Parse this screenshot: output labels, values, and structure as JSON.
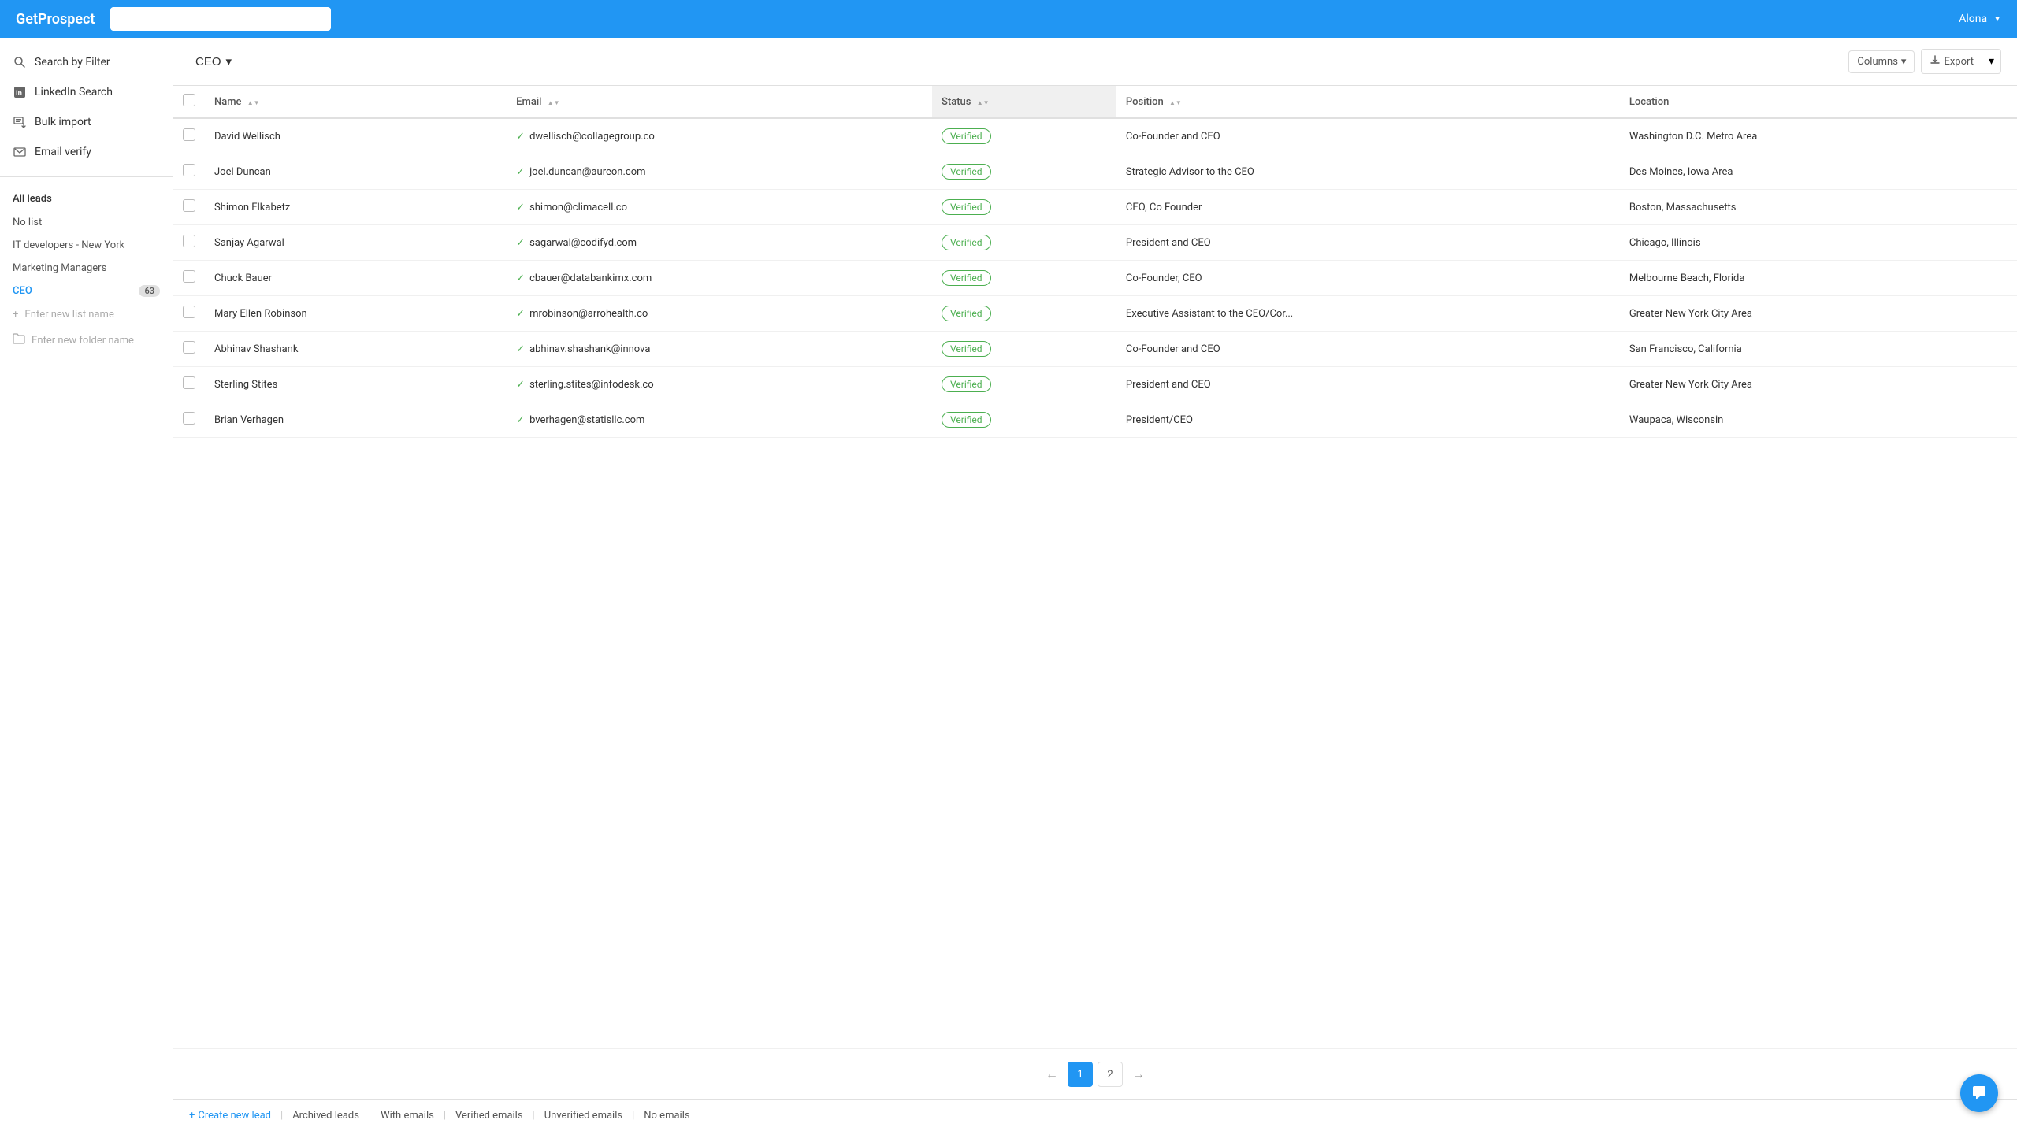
{
  "header": {
    "logo": "GetProspect",
    "search_placeholder": "",
    "user": "Alona"
  },
  "sidebar": {
    "nav_items": [
      {
        "id": "search-filter",
        "label": "Search by Filter",
        "icon": "search"
      },
      {
        "id": "linkedin-search",
        "label": "LinkedIn Search",
        "icon": "linkedin"
      },
      {
        "id": "bulk-import",
        "label": "Bulk import",
        "icon": "bulk"
      },
      {
        "id": "email-verify",
        "label": "Email verify",
        "icon": "email"
      }
    ],
    "all_leads_label": "All leads",
    "no_list_label": "No list",
    "lists": [
      {
        "id": "it-developers",
        "label": "IT developers - New York",
        "count": null
      },
      {
        "id": "marketing-managers",
        "label": "Marketing Managers",
        "count": null
      },
      {
        "id": "ceo",
        "label": "CEO",
        "count": "63",
        "active": true
      }
    ],
    "add_list_placeholder": "Enter new list name",
    "add_folder_placeholder": "Enter new folder name"
  },
  "toolbar": {
    "list_title": "CEO",
    "columns_label": "Columns",
    "export_label": "Export"
  },
  "table": {
    "columns": [
      {
        "id": "name",
        "label": "Name",
        "sortable": true
      },
      {
        "id": "email",
        "label": "Email",
        "sortable": true
      },
      {
        "id": "status",
        "label": "Status",
        "sortable": true,
        "highlighted": true
      },
      {
        "id": "position",
        "label": "Position",
        "sortable": true
      },
      {
        "id": "location",
        "label": "Location",
        "sortable": false
      }
    ],
    "rows": [
      {
        "id": 1,
        "name": "David Wellisch",
        "email": "dwellisch@collagegroup.co",
        "email_verified": true,
        "status": "Verified",
        "position": "Co-Founder and CEO",
        "location": "Washington D.C. Metro Area"
      },
      {
        "id": 2,
        "name": "Joel Duncan",
        "email": "joel.duncan@aureon.com",
        "email_verified": true,
        "status": "Verified",
        "position": "Strategic Advisor to the CEO",
        "location": "Des Moines, Iowa Area"
      },
      {
        "id": 3,
        "name": "Shimon Elkabetz",
        "email": "shimon@climacell.co",
        "email_verified": true,
        "status": "Verified",
        "position": "CEO, Co Founder",
        "location": "Boston, Massachusetts"
      },
      {
        "id": 4,
        "name": "Sanjay Agarwal",
        "email": "sagarwal@codifyd.com",
        "email_verified": true,
        "status": "Verified",
        "position": "President and CEO",
        "location": "Chicago, Illinois"
      },
      {
        "id": 5,
        "name": "Chuck Bauer",
        "email": "cbauer@databankimx.com",
        "email_verified": true,
        "status": "Verified",
        "position": "Co-Founder, CEO",
        "location": "Melbourne Beach, Florida"
      },
      {
        "id": 6,
        "name": "Mary Ellen Robinson",
        "email": "mrobinson@arrohealth.co",
        "email_verified": true,
        "status": "Verified",
        "position": "Executive Assistant to the CEO/Cor...",
        "location": "Greater New York City Area"
      },
      {
        "id": 7,
        "name": "Abhinav Shashank",
        "email": "abhinav.shashank@innova",
        "email_verified": true,
        "status": "Verified",
        "position": "Co-Founder and CEO",
        "location": "San Francisco, California"
      },
      {
        "id": 8,
        "name": "Sterling Stites",
        "email": "sterling.stites@infodesk.co",
        "email_verified": true,
        "status": "Verified",
        "position": "President and CEO",
        "location": "Greater New York City Area"
      },
      {
        "id": 9,
        "name": "Brian Verhagen",
        "email": "bverhagen@statisllc.com",
        "email_verified": true,
        "status": "Verified",
        "position": "President/CEO",
        "location": "Waupaca, Wisconsin"
      }
    ]
  },
  "pagination": {
    "current_page": 1,
    "pages": [
      "1",
      "2"
    ],
    "prev_arrow": "←",
    "next_arrow": "→"
  },
  "footer": {
    "create_lead": "Create new lead",
    "archived_leads": "Archived leads",
    "with_emails": "With emails",
    "verified_emails": "Verified emails",
    "unverified_emails": "Unverified emails",
    "no_emails": "No emails"
  },
  "colors": {
    "primary": "#2196F3",
    "verified": "#4CAF50",
    "status_bg": "#f0f0f0"
  }
}
